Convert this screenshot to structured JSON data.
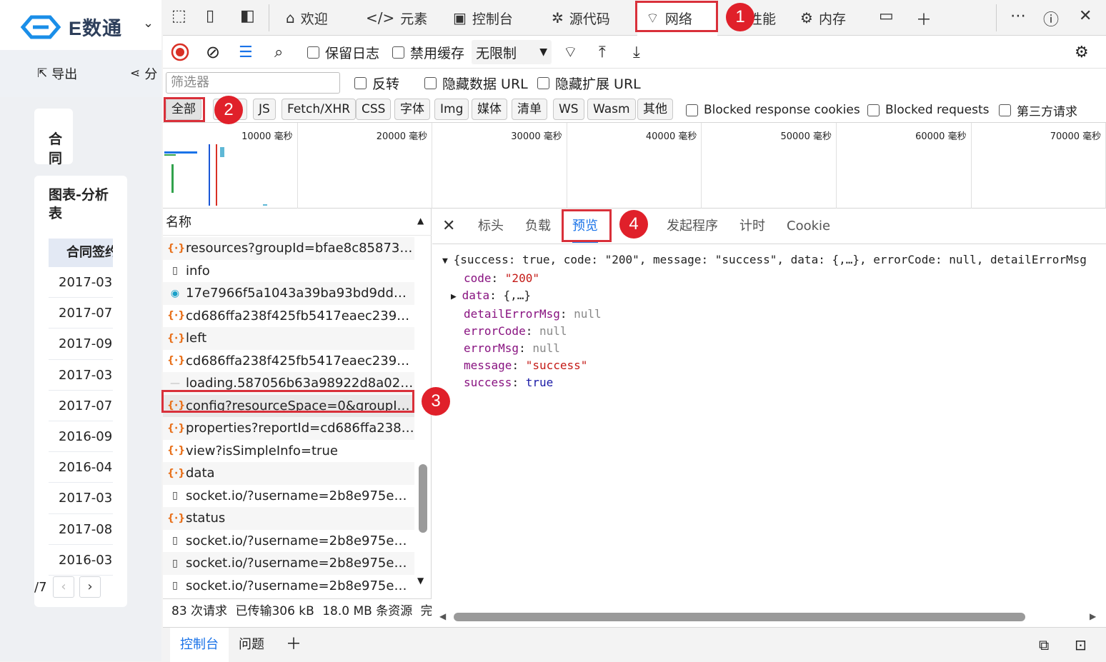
{
  "app": {
    "logo_text": "E数通",
    "toolbar": {
      "export": "导出",
      "share": "分"
    },
    "card_contract_title": "合同",
    "card_chart_title": "图表-分析表",
    "table_header": "合同签约",
    "dates": [
      "2017-03-",
      "2017-07-",
      "2017-09-",
      "2017-03-",
      "2017-07-",
      "2016-09-",
      "2016-04-",
      "2017-03-",
      "2017-08-",
      "2016-03-"
    ],
    "pager_text": "/7"
  },
  "tabs": {
    "welcome": "欢迎",
    "elements": "元素",
    "console": "控制台",
    "sources": "源代码",
    "network": "网络",
    "performance": "性能",
    "memory": "内存"
  },
  "network_toolbar": {
    "preserve_log": "保留日志",
    "disable_cache": "禁用缓存",
    "throttle": "无限制"
  },
  "filter_bar": {
    "placeholder": "筛选器",
    "invert": "反转",
    "hide_data_urls": "隐藏数据 URL",
    "hide_ext_urls": "隐藏扩展 URL"
  },
  "type_filters": {
    "all": "全部",
    "doc": "文档",
    "js": "JS",
    "fetch": "Fetch/XHR",
    "css": "CSS",
    "font": "字体",
    "img": "Img",
    "media": "媒体",
    "manifest": "清单",
    "ws": "WS",
    "wasm": "Wasm",
    "other": "其他",
    "blocked_cookies": "Blocked response cookies",
    "blocked_requests": "Blocked requests",
    "third_party": "第三方请求"
  },
  "overview": {
    "labels": [
      "10000 毫秒",
      "20000 毫秒",
      "30000 毫秒",
      "40000 毫秒",
      "50000 毫秒",
      "60000 毫秒",
      "70000 毫秒"
    ]
  },
  "request_list": {
    "header": "名称",
    "rows": [
      {
        "icon": "xhr",
        "name": "resources?groupId=bfae8c858734448..."
      },
      {
        "icon": "doc",
        "name": "info"
      },
      {
        "icon": "img",
        "name": "17e7966f5a1043a39ba93bd9dd00213..."
      },
      {
        "icon": "xhr",
        "name": "cd686ffa238f425fb5417eaec2390006"
      },
      {
        "icon": "xhr",
        "name": "left"
      },
      {
        "icon": "xhr",
        "name": "cd686ffa238f425fb5417eaec2390006?..."
      },
      {
        "icon": "png",
        "name": "loading.587056b63a98922d8a02.png"
      },
      {
        "icon": "xhr",
        "name": "config?resourceSpace=0&groupId=bf..."
      },
      {
        "icon": "xhr",
        "name": "properties?reportId=cd686ffa238f425..."
      },
      {
        "icon": "xhr",
        "name": "view?isSimpleInfo=true"
      },
      {
        "icon": "xhr",
        "name": "data"
      },
      {
        "icon": "doc",
        "name": "socket.io/?username=2b8e975ee4704..."
      },
      {
        "icon": "xhr",
        "name": "status"
      },
      {
        "icon": "doc",
        "name": "socket.io/?username=2b8e975ee4704..."
      },
      {
        "icon": "doc",
        "name": "socket.io/?username=2b8e975ee4704..."
      },
      {
        "icon": "doc",
        "name": "socket.io/?username=2b8e975ee4704..."
      }
    ]
  },
  "status_bar": {
    "requests": "83 次请求",
    "transferred": "已传输306 kB",
    "resources": "18.0 MB 条资源",
    "finish": "完"
  },
  "detail_tabs": {
    "headers": "标头",
    "payload": "负载",
    "preview": "预览",
    "response": "响应",
    "initiator": "发起程序",
    "timing": "计时",
    "cookie": "Cookie"
  },
  "preview": {
    "summary": "{success: true, code: \"200\", message: \"success\", data: {,…}, errorCode: null, detailErrorMsg",
    "code_key": "code",
    "code_val": "\"200\"",
    "data_key": "data",
    "data_val": "{,…}",
    "detail_key": "detailErrorMsg",
    "detail_val": "null",
    "ecode_key": "errorCode",
    "ecode_val": "null",
    "emsg_key": "errorMsg",
    "emsg_val": "null",
    "msg_key": "message",
    "msg_val": "\"success\"",
    "succ_key": "success",
    "succ_val": "true"
  },
  "drawer": {
    "console": "控制台",
    "issues": "问题"
  },
  "annotations": {
    "b1": "1",
    "b2": "2",
    "b3": "3",
    "b4": "4"
  },
  "colors": {
    "accent": "#1a73e8",
    "highlight": "#d9303a",
    "xhr_icon": "#e8711c"
  }
}
